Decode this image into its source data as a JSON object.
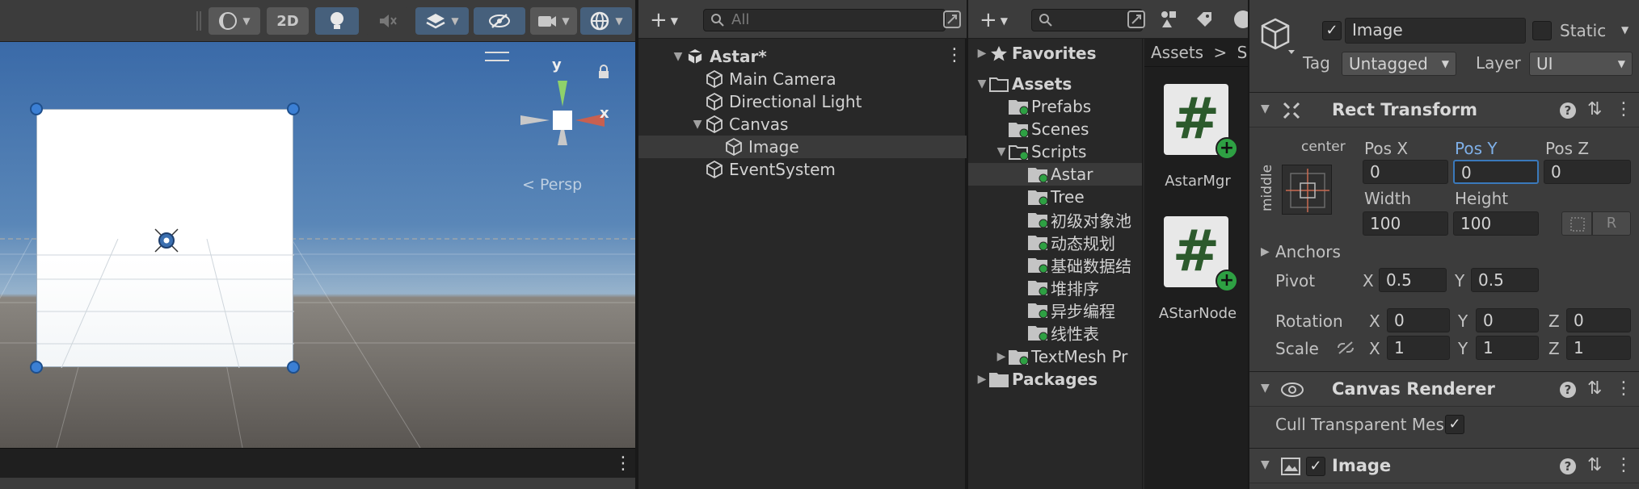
{
  "scene": {
    "toolbar": {
      "mode_2d": "2D"
    },
    "gizmo": {
      "y_label": "y",
      "x_label": "x",
      "persp_label": "< Persp"
    }
  },
  "hierarchy": {
    "search_placeholder": "All",
    "items": [
      {
        "label": "Astar*",
        "depth": 0,
        "caret": "▼",
        "type": "scene"
      },
      {
        "label": "Main Camera",
        "depth": 1,
        "caret": "",
        "type": "object"
      },
      {
        "label": "Directional Light",
        "depth": 1,
        "caret": "",
        "type": "object"
      },
      {
        "label": "Canvas",
        "depth": 1,
        "caret": "▼",
        "type": "object"
      },
      {
        "label": "Image",
        "depth": 2,
        "caret": "",
        "type": "object",
        "selected": true
      },
      {
        "label": "EventSystem",
        "depth": 1,
        "caret": "",
        "type": "object"
      }
    ]
  },
  "project": {
    "search_placeholder": "",
    "breadcrumb": {
      "root": "Assets",
      "sep": ">",
      "current": "Sc"
    },
    "tree": [
      {
        "label": "Favorites",
        "depth": 0,
        "caret": "▶",
        "kind": "star",
        "bold": true
      },
      {
        "label": "Assets",
        "depth": 0,
        "caret": "▼",
        "kind": "folder-open",
        "bold": true
      },
      {
        "label": "Prefabs",
        "depth": 1,
        "caret": "",
        "kind": "folder"
      },
      {
        "label": "Scenes",
        "depth": 1,
        "caret": "",
        "kind": "folder"
      },
      {
        "label": "Scripts",
        "depth": 1,
        "caret": "▼",
        "kind": "folder-open"
      },
      {
        "label": "Astar",
        "depth": 2,
        "caret": "",
        "kind": "folder",
        "selected": true
      },
      {
        "label": "Tree",
        "depth": 2,
        "caret": "",
        "kind": "folder"
      },
      {
        "label": "初级对象池",
        "depth": 2,
        "caret": "",
        "kind": "folder"
      },
      {
        "label": "动态规划",
        "depth": 2,
        "caret": "",
        "kind": "folder"
      },
      {
        "label": "基础数据结",
        "depth": 2,
        "caret": "",
        "kind": "folder"
      },
      {
        "label": "堆排序",
        "depth": 2,
        "caret": "",
        "kind": "folder"
      },
      {
        "label": "异步编程",
        "depth": 2,
        "caret": "",
        "kind": "folder"
      },
      {
        "label": "线性表",
        "depth": 2,
        "caret": "",
        "kind": "folder"
      },
      {
        "label": "TextMesh Pr",
        "depth": 1,
        "caret": "▶",
        "kind": "folder"
      },
      {
        "label": "Packages",
        "depth": 0,
        "caret": "▶",
        "kind": "folder",
        "bold": true
      }
    ],
    "assets": [
      {
        "name": "AstarMgr",
        "glyph": "#"
      },
      {
        "name": "AStarNode",
        "glyph": "#"
      }
    ]
  },
  "inspector": {
    "object_name": "Image",
    "active": "✓",
    "static_label": "Static",
    "tag_label": "Tag",
    "tag_value": "Untagged",
    "layer_label": "Layer",
    "layer_value": "UI",
    "rect_transform": {
      "title": "Rect Transform",
      "anchor_h": "center",
      "anchor_v": "middle",
      "pos_x_label": "Pos X",
      "pos_x": "0",
      "pos_y_label": "Pos Y",
      "pos_y": "0",
      "pos_z_label": "Pos Z",
      "pos_z": "0",
      "width_label": "Width",
      "width": "100",
      "height_label": "Height",
      "height": "100",
      "r_button": "R",
      "anchors_label": "Anchors",
      "pivot_label": "Pivot",
      "pivot_x": "0.5",
      "pivot_y": "0.5",
      "rotation_label": "Rotation",
      "rot_x": "0",
      "rot_y": "0",
      "rot_z": "0",
      "scale_label": "Scale",
      "scale_x": "1",
      "scale_y": "1",
      "scale_z": "1",
      "x_label": "X",
      "y_label": "Y",
      "z_label": "Z"
    },
    "canvas_renderer": {
      "title": "Canvas Renderer",
      "cull_label": "Cull Transparent Mes",
      "cull_value": "✓"
    },
    "image": {
      "title": "Image",
      "enabled": "✓"
    },
    "help_glyph": "?",
    "preset_glyph": "⇅",
    "kebab_glyph": "⋮"
  },
  "colors": {
    "selection": "#3a3a3a",
    "accent_blue": "#46607c",
    "focus_border": "#3a79bb",
    "script_green": "#2ea043"
  }
}
